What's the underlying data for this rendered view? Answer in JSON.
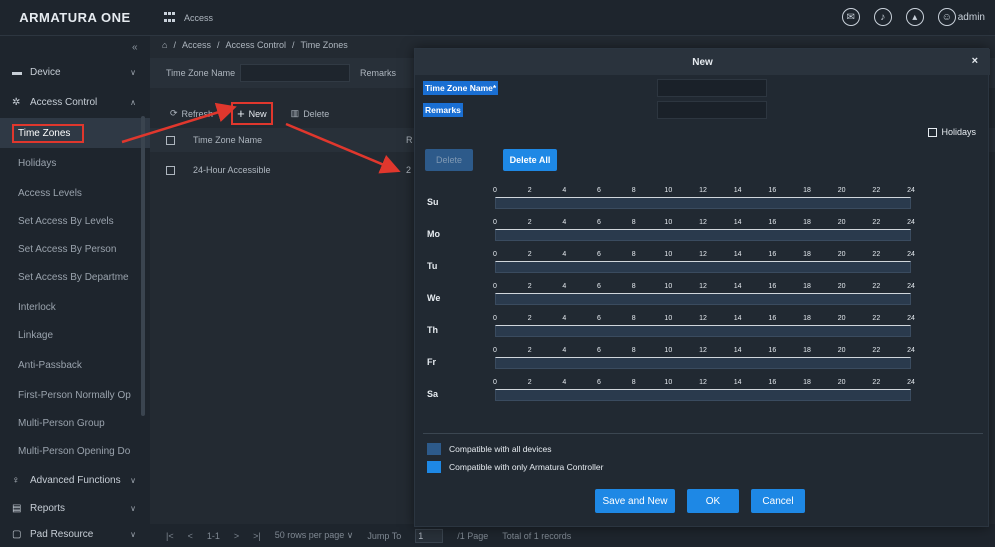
{
  "app": {
    "brand": "ARMATURA ONE",
    "module": "Access",
    "user": "admin"
  },
  "sidebar": {
    "collapse_glyph": "«",
    "sections": [
      {
        "label": "Device",
        "icon": "device-icon",
        "arrow": "∨"
      },
      {
        "label": "Access Control",
        "icon": "gear-icon",
        "arrow": "∧"
      }
    ],
    "sub_items": [
      "Time Zones",
      "Holidays",
      "Access Levels",
      "Set Access By Levels",
      "Set Access By Person",
      "Set Access By Departme",
      "Interlock",
      "Linkage",
      "Anti-Passback",
      "First-Person Normally Op",
      "Multi-Person Group",
      "Multi-Person Opening Do"
    ],
    "bottom_sections": [
      {
        "label": "Advanced Functions",
        "arrow": "∨"
      },
      {
        "label": "Reports",
        "arrow": "∨"
      },
      {
        "label": "Pad Resource",
        "arrow": "∨"
      }
    ]
  },
  "breadcrumb": [
    "Access",
    "Access Control",
    "Time Zones"
  ],
  "filters": {
    "name_label": "Time Zone Name",
    "remarks_label": "Remarks"
  },
  "toolbar": {
    "refresh": "Refresh",
    "new": "New",
    "delete": "Delete"
  },
  "table": {
    "header": "Time Zone Name",
    "header_cut": "R",
    "rows": [
      {
        "name": "24-Hour Accessible",
        "cut": "2"
      }
    ]
  },
  "pager": {
    "range": "1-1",
    "per_page": "50 rows per page",
    "jump_label": "Jump To",
    "jump_value": "1",
    "page_info": "/1 Page",
    "total": "Total of 1 records"
  },
  "modal": {
    "title": "New",
    "close": "×",
    "name_label": "Time Zone Name*",
    "remarks_label": "Remarks",
    "holidays": "Holidays",
    "delete": "Delete",
    "delete_all": "Delete All",
    "days": [
      "Su",
      "Mo",
      "Tu",
      "We",
      "Th",
      "Fr",
      "Sa"
    ],
    "hours": [
      "0",
      "2",
      "4",
      "6",
      "8",
      "10",
      "12",
      "14",
      "16",
      "18",
      "20",
      "22",
      "24"
    ],
    "compat_all": "Compatible with all devices",
    "compat_armatura": "Compatible with only Armatura Controller",
    "save_and_new": "Save and New",
    "ok": "OK",
    "cancel": "Cancel"
  },
  "colors": {
    "accent": "#1e88e5",
    "highlight": "#e0372d",
    "background": "#1b2229"
  }
}
